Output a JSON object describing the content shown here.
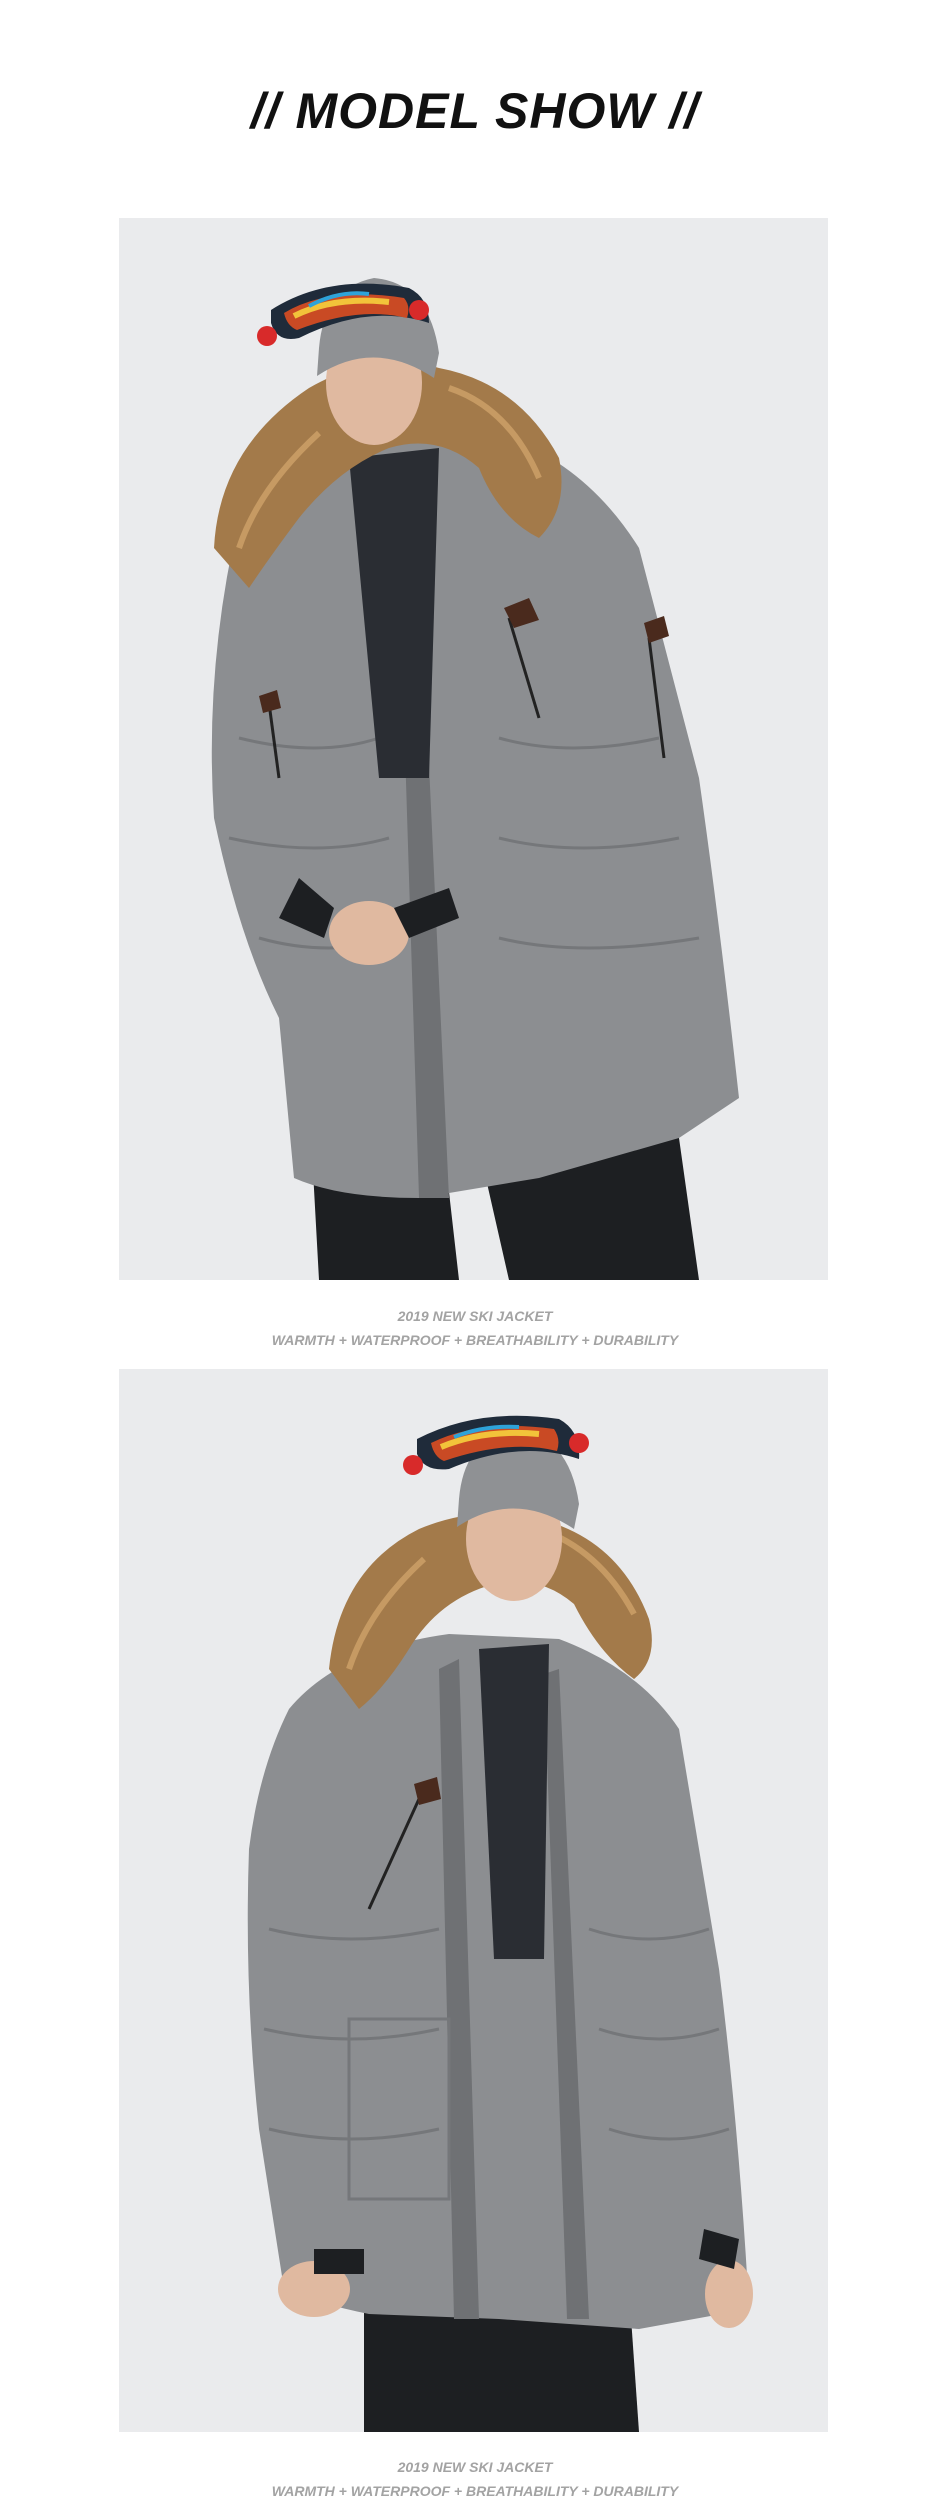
{
  "header": {
    "title": "/// MODEL SHOW ///",
    "title_display": "// MODEL SHOW //"
  },
  "photos": [
    {
      "caption_line1": "2019 NEW SKI JACKET",
      "caption_line2": "WARMTH + WATERPROOF + BREATHABILITY + DURABILITY"
    },
    {
      "caption_line1": "2019 NEW SKI JACKET",
      "caption_line2": "WARMTH + WATERPROOF + BREATHABILITY + DURABILITY"
    }
  ],
  "colors": {
    "background": "#ffffff",
    "photo_background": "#e9eaec",
    "title": "#111111",
    "caption": "#a3a3a3",
    "jacket": "#8a8c8f",
    "fur": "#a37a4a",
    "pants": "#1d1f22"
  }
}
